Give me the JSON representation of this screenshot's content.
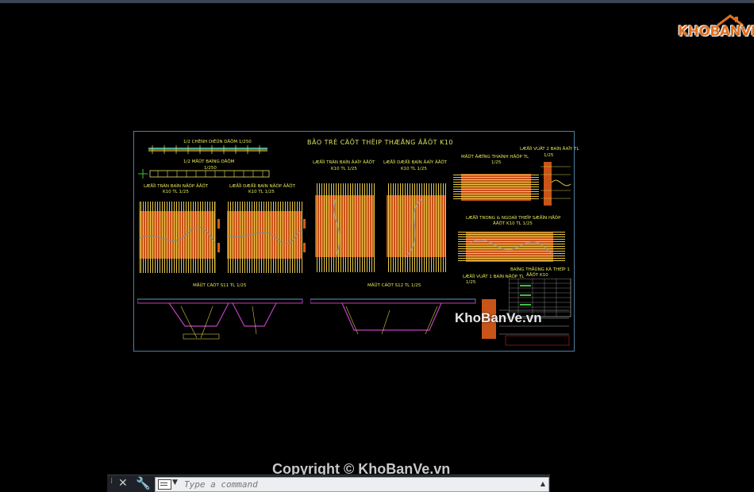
{
  "logo": {
    "text": "KHOBANVE"
  },
  "sheet": {
    "title": "BÃO TRÈ CÄÕT THËIP THÆÅNG ÂÅÖT K10",
    "labels": {
      "plan_elevation": "1/2 CHÊNH DIÊÛN DÂÖM 1/250",
      "plan_beam": "1/2  MÄÜT BAÌNG DÂÖM",
      "plan_scale": "1/250",
      "l1": "LÆÅÏI TRÃN BAÍN NÄÕP ÂÅÖT",
      "l1s": "K10 TL 1/25",
      "l2": "LÆÅÏI DÆÅÏI BAÍN NÄÕP ÂÅÖT",
      "l2s": "K10 TL 1/25",
      "l3": "LÆÅÏI TRÃN BAÍN ÂAÏY ÂÅÖT",
      "l3s": "K10 TL 1/25",
      "l4": "LÆÅÏI DÆÅÏI BAÍN ÂAÏY ÂÅÖT",
      "l4s": "K10 TL 1/25",
      "l5": "MÄÜT ÂÆÏNG THAÌNH HÄÕP TL",
      "l5s": "1/25",
      "l6": "LÆÅÏI VUÄT 2 BAÍN ÂAÏY TL",
      "l6s": "1/25",
      "l7": "LÆÅÏI TRONG & NGOAÌI THEÏP SÆÅÌN HÄÕP",
      "l7s": "ÂÅÖT K10 TL 1/25",
      "s1": "MÄÜT CÀÕT S11 TL 1/25",
      "s2": "MÄÜT CÀÕT S12 TL 1/25",
      "l8": "LÆÅÏI VUÄT 1 BAÍN NÄÕP TL",
      "l8s": "1/25",
      "table_title": "BAÍNG THÄÚNG KÃ THEÏP 1",
      "table_sub": "ÂÅÖT K10"
    }
  },
  "watermark": "KhoBanVe.vn",
  "copyright": "Copyright © KhoBanVe.vn",
  "command": {
    "placeholder": "Type a command"
  },
  "colors": {
    "bg": "#000000",
    "sheet_border": "#4f7fa0",
    "text": "#e7e75a",
    "rebar_orange": "#d0601a",
    "rebar_yellow": "#d8c64a",
    "section_magenta": "#c040c0"
  }
}
